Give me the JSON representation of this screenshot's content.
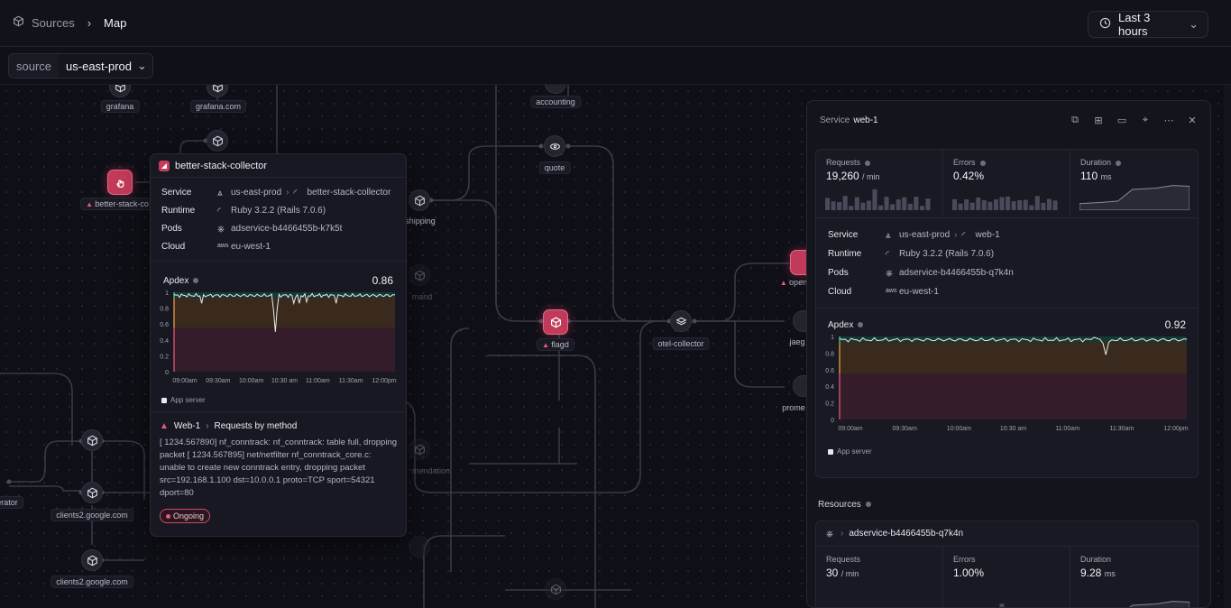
{
  "breadcrumb": {
    "root": "Sources",
    "current": "Map"
  },
  "time_range": {
    "label": "Last 3 hours"
  },
  "filter": {
    "key": "source",
    "value": "us-east-prod"
  },
  "nodes": [
    {
      "id": "grafana",
      "label": "grafana"
    },
    {
      "id": "grafana-com",
      "label": "grafana.com"
    },
    {
      "id": "accounting",
      "label": "accounting"
    },
    {
      "id": "quote",
      "label": "quote"
    },
    {
      "id": "shipping",
      "label": "shipping"
    },
    {
      "id": "command",
      "label": "mand"
    },
    {
      "id": "flagd",
      "label": "flagd"
    },
    {
      "id": "otel-collector",
      "label": "otel-collector"
    },
    {
      "id": "opensearch",
      "label": "open"
    },
    {
      "id": "jaeger",
      "label": "jaeg"
    },
    {
      "id": "prometheus",
      "label": "prome"
    },
    {
      "id": "recommendation",
      "label": "mendation"
    },
    {
      "id": "load-generator",
      "label": "erator"
    },
    {
      "id": "clients2-a",
      "label": "clients2.google.com"
    },
    {
      "id": "clients2-b",
      "label": "clients2.google.com"
    },
    {
      "id": "better-stack",
      "label": "better-stack-co"
    }
  ],
  "popover": {
    "title": "better-stack-collector",
    "rows": [
      {
        "key": "Service",
        "a": "us-east-prod",
        "b": "better-stack-collector"
      },
      {
        "key": "Runtime",
        "a": "Ruby 3.2.2 (Rails 7.0.6)"
      },
      {
        "key": "Pods",
        "a": "adservice-b4466455b-k7k5t"
      },
      {
        "key": "Cloud",
        "a": "eu-west-1"
      }
    ],
    "apdex": {
      "label": "Apdex",
      "value": "0.86"
    },
    "y_ticks": [
      "1",
      "0.8",
      "0.6",
      "0.4",
      "0.2",
      "0"
    ],
    "x_ticks": [
      "09:00am",
      "09:30am",
      "10:00am",
      "10:30 am",
      "11:00am",
      "11:30am",
      "12:00pm"
    ],
    "legend": "App server",
    "incident": {
      "service": "Web-1",
      "title": "Requests by method",
      "log": "[ 1234.567890] nf_conntrack: nf_conntrack: table full, dropping packet [ 1234.567895] net/netfilter nf_conntrack_core.c: unable to create new conntrack entry, dropping packet src=192.168.1.100 dst=10.0.0.1 proto=TCP sport=54321 dport=80",
      "status": "Ongoing"
    }
  },
  "panel": {
    "title_prefix": "Service",
    "title_name": "web-1",
    "metrics": [
      {
        "label": "Requests",
        "value": "19,260",
        "unit": "/ min"
      },
      {
        "label": "Errors",
        "value": "0.42%",
        "unit": ""
      },
      {
        "label": "Duration",
        "value": "110",
        "unit": "ms"
      }
    ],
    "rows": [
      {
        "key": "Service",
        "a": "us-east-prod",
        "b": "web-1"
      },
      {
        "key": "Runtime",
        "a": "Ruby 3.2.2 (Rails 7.0.6)"
      },
      {
        "key": "Pods",
        "a": "adservice-b4466455b-q7k4n"
      },
      {
        "key": "Cloud",
        "a": "eu-west-1"
      }
    ],
    "apdex": {
      "label": "Apdex",
      "value": "0.92"
    },
    "y_ticks": [
      "1",
      "0.8",
      "0.6",
      "0.4",
      "0.2",
      "0"
    ],
    "x_ticks": [
      "09:00am",
      "09:30am",
      "10:00am",
      "10:30 am",
      "11:00am",
      "11:30am",
      "12:00pm"
    ],
    "legend": "App server",
    "resources": {
      "label": "Resources",
      "name": "adservice-b4466455b-q7k4n",
      "metrics": [
        {
          "label": "Requests",
          "value": "30",
          "unit": "/ min"
        },
        {
          "label": "Errors",
          "value": "1.00%",
          "unit": ""
        },
        {
          "label": "Duration",
          "value": "9.28",
          "unit": "ms"
        }
      ]
    }
  },
  "colors": {
    "alert": "#c23a59",
    "good_band": "#153a33",
    "warn_band": "#3a2a1e",
    "bad_band": "#351c2a",
    "line": "#e8e8ee"
  }
}
